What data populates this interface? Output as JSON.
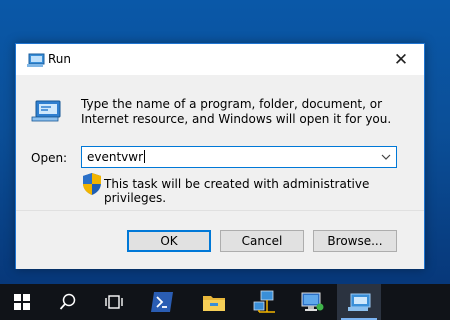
{
  "dialog": {
    "title": "Run",
    "close_glyph": "✕",
    "description": "Type the name of a program, folder, document, or Internet resource, and Windows will open it for you.",
    "open_label": "Open:",
    "open_value": "eventvwr",
    "admin_notice": "This task will be created with administrative privileges.",
    "buttons": {
      "ok": "OK",
      "cancel": "Cancel",
      "browse": "Browse..."
    }
  },
  "taskbar": {
    "items": [
      {
        "icon": "windows-start-icon"
      },
      {
        "icon": "search-icon"
      },
      {
        "icon": "task-view-icon"
      },
      {
        "icon": "powershell-icon"
      },
      {
        "icon": "file-explorer-icon"
      },
      {
        "icon": "network-icon"
      },
      {
        "icon": "remote-desktop-icon"
      },
      {
        "icon": "run-app-icon",
        "active": true
      }
    ]
  },
  "colors": {
    "accent": "#0078d7",
    "taskbar": "#101318",
    "desktop": "#0b4f98"
  }
}
